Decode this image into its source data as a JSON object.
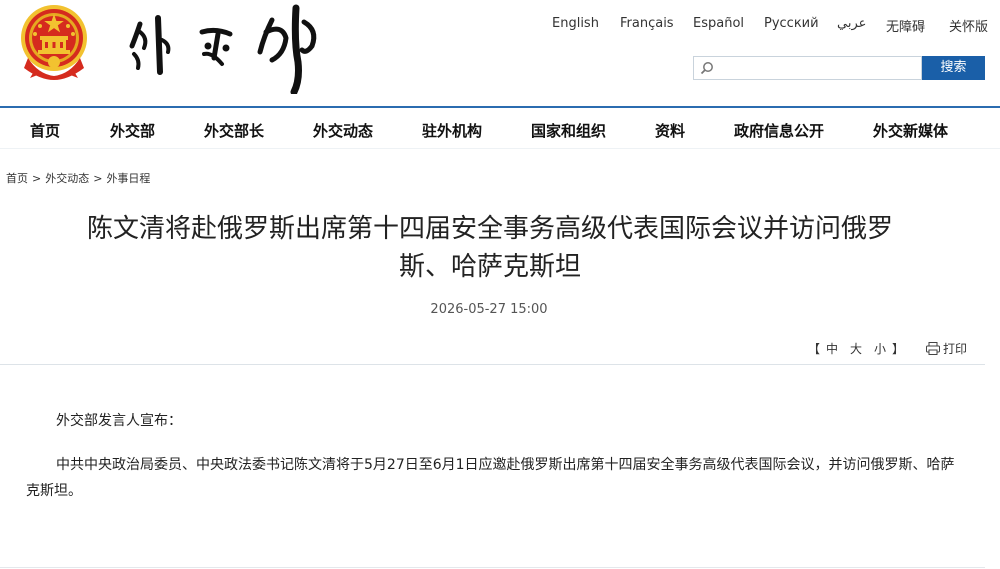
{
  "languages": [
    "English",
    "Français",
    "Español",
    "Русский",
    "عربي",
    "无障碍",
    "关怀版"
  ],
  "search": {
    "placeholder": "",
    "button_label": "搜索"
  },
  "nav": {
    "items": [
      "首页",
      "外交部",
      "外交部长",
      "外交动态",
      "驻外机构",
      "国家和组织",
      "资料",
      "政府信息公开",
      "外交新媒体"
    ]
  },
  "breadcrumb": {
    "items": [
      "首页",
      "外交动态",
      "外事日程"
    ],
    "separator": ">"
  },
  "article": {
    "title_line1": "陈文清将赴俄罗斯出席第十四届安全事务高级代表国际会议并访问俄罗",
    "title_line2": "斯、哈萨克斯坦",
    "date": "2026-05-27 15:00",
    "paragraphs": [
      "外交部发言人宣布：",
      "中共中央政治局委员、中央政法委书记陈文清将于5月27日至6月1日应邀赴俄罗斯出席第十四届安全事务高级代表国际会议，并访问俄罗斯、哈萨克斯坦。"
    ]
  },
  "tools": {
    "bracket_open": "【",
    "bracket_close": "】",
    "font_sizes": [
      "中",
      "大",
      "小"
    ],
    "print_label": "打印"
  },
  "colors": {
    "accent": "#1a5fa8",
    "nav_line": "#2b6cb0",
    "emblem_red": "#d52b1e",
    "emblem_gold": "#f2c230"
  }
}
